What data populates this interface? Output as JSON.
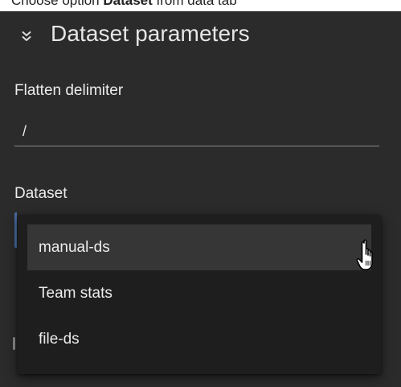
{
  "top_strip": {
    "prefix": "Choose option ",
    "bold": "Dataset",
    "suffix": " from data tab"
  },
  "section": {
    "title": "Dataset parameters",
    "collapse_icon": "chevron-double-down-icon"
  },
  "fields": {
    "flatten_delimiter": {
      "label": "Flatten delimiter",
      "value": "/"
    },
    "dataset": {
      "label": "Dataset"
    }
  },
  "dropdown": {
    "options": [
      "manual-ds",
      "Team stats",
      "file-ds"
    ],
    "highlighted_index": 0
  },
  "cursor": {
    "icon": "hand-pointer-icon"
  },
  "colors": {
    "panel_background": "#2b2b2c",
    "dropdown_background": "#1e1e1f",
    "highlight_background": "#363637",
    "text": "#ececec"
  }
}
